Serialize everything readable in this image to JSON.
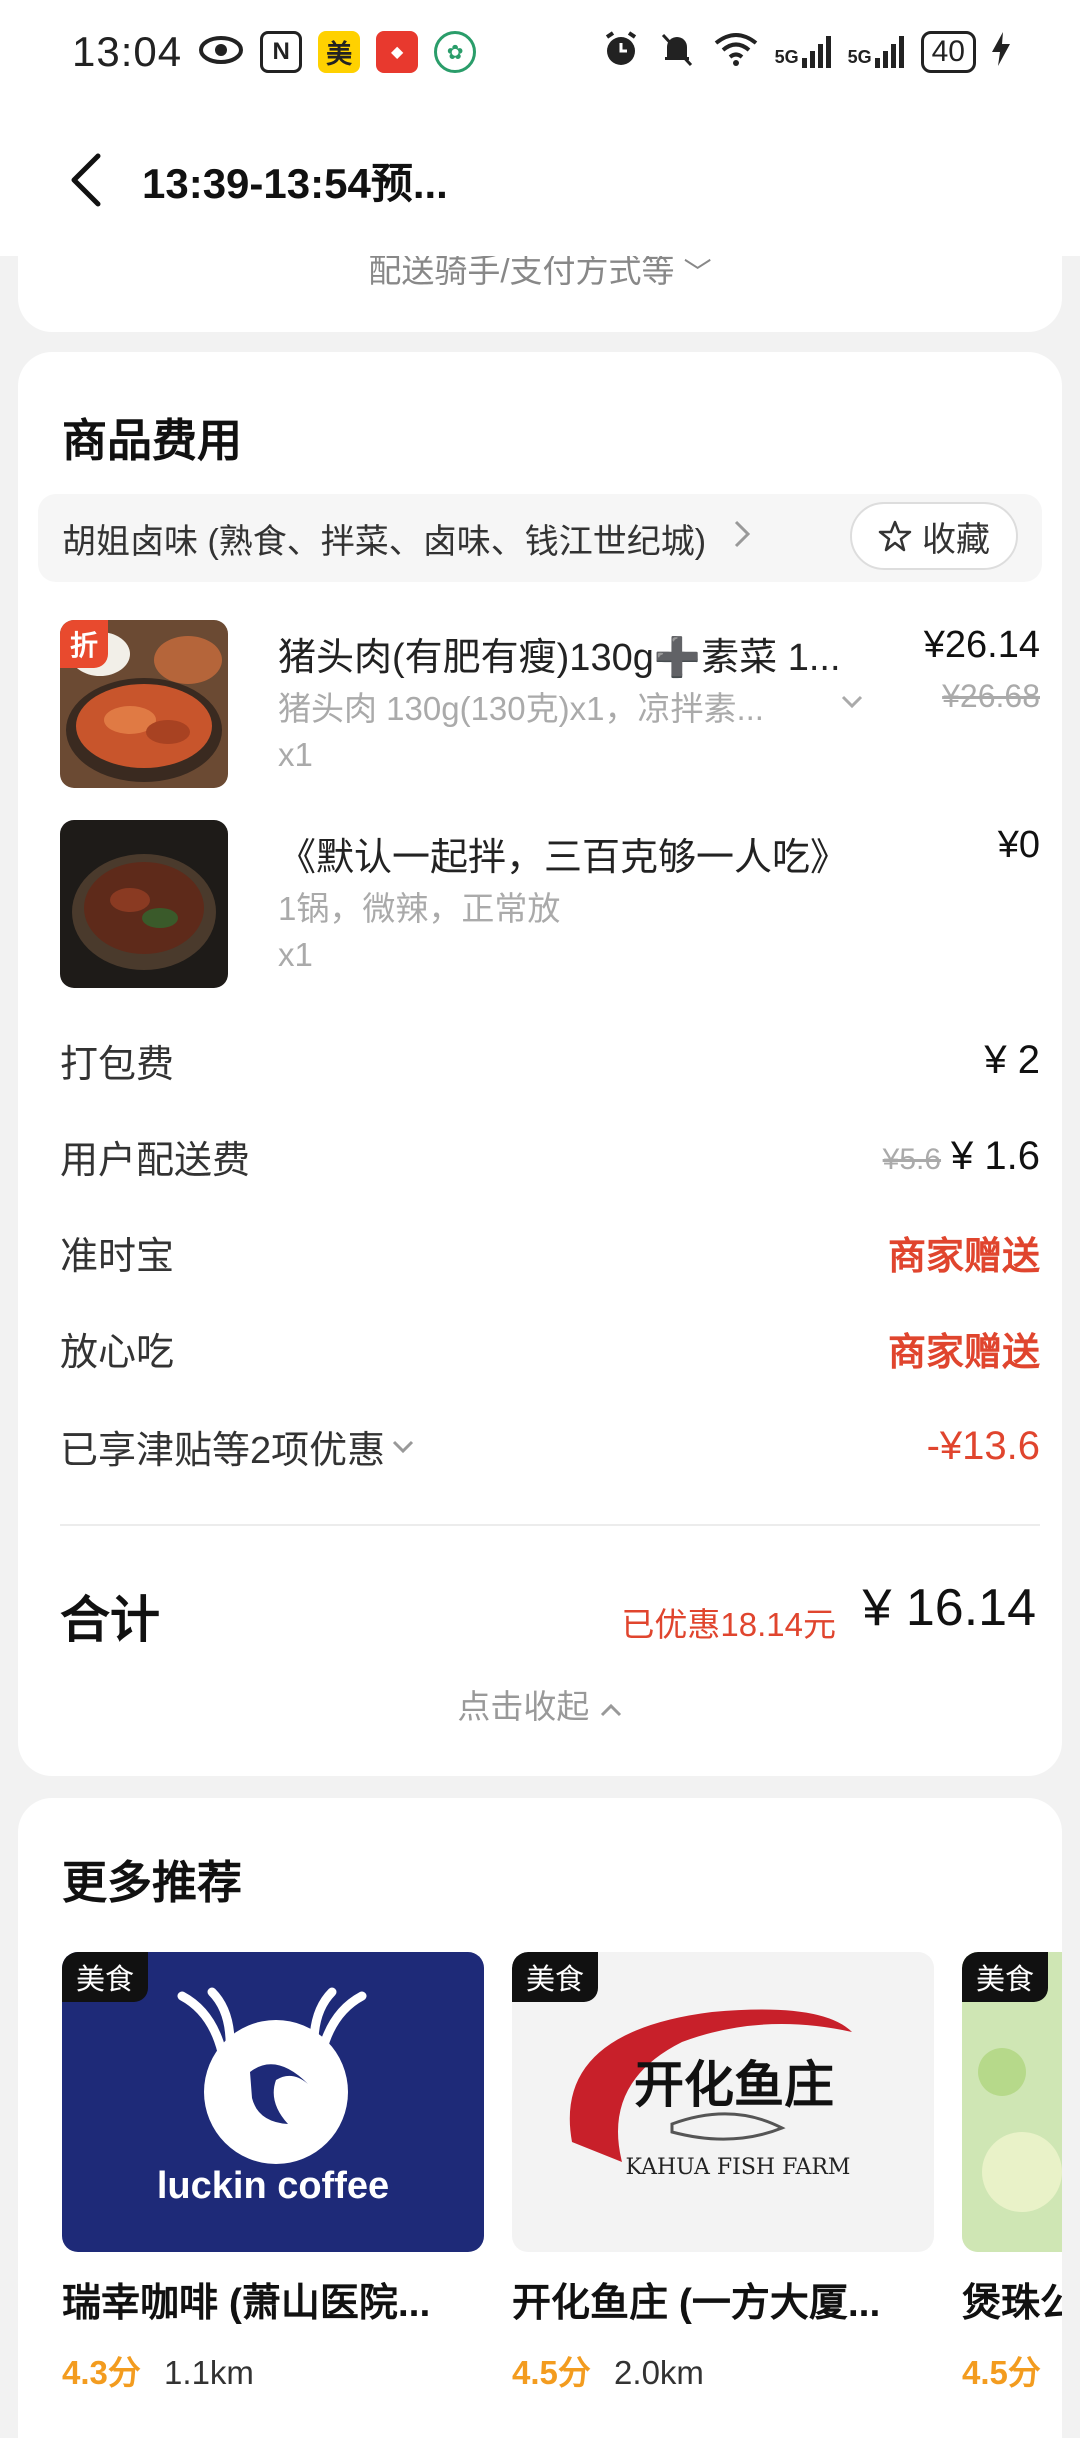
{
  "status_bar": {
    "time": "13:04",
    "app_icons": [
      "eye-icon",
      "nfc-icon",
      "meituan-icon",
      "news-icon",
      "leaf-icon"
    ],
    "network": [
      "5G",
      "5G"
    ],
    "battery": "40"
  },
  "header": {
    "title": "13:39-13:54预..."
  },
  "order_info": {
    "rider_link": "配送骑手/支付方式等"
  },
  "fee_section": {
    "title": "商品费用",
    "shop_name": "胡姐卤味 (熟食、拌菜、卤味、钱江世纪城)",
    "favorite_label": "收藏",
    "items": [
      {
        "name": "猪头肉(有肥有瘦)130g➕素菜 1...",
        "spec": "猪头肉 130g(130克)x1，凉拌素...",
        "qty": "x1",
        "price": "¥26.14",
        "original_price": "¥26.68",
        "tag": "折"
      },
      {
        "name": "《默认一起拌，三百克够一人吃》",
        "spec": "1锅，微辣，正常放",
        "qty": "x1",
        "price": "¥0"
      }
    ],
    "fees": {
      "packing": {
        "label": "打包费",
        "value": "¥ 2"
      },
      "delivery": {
        "label": "用户配送费",
        "original": "¥5.6",
        "value": "¥ 1.6"
      },
      "ontime": {
        "label": "准时宝",
        "value": "商家赠送"
      },
      "safe": {
        "label": "放心吃",
        "value": "商家赠送"
      },
      "discount": {
        "label": "已享津贴等2项优惠",
        "value": "-¥13.6"
      }
    },
    "total": {
      "label": "合计",
      "saved": "已优惠18.14元",
      "value": "¥ 16.14"
    },
    "collapse_label": "点击收起"
  },
  "recommendations": {
    "title": "更多推荐",
    "tag": "美食",
    "cards": [
      {
        "name": "瑞幸咖啡 (萧山医院...",
        "score": "4.3分",
        "distance": "1.1km",
        "logo_text": "luckin coffee"
      },
      {
        "name": "开化鱼庄 (一方大厦...",
        "score": "4.5分",
        "distance": "2.0km",
        "logo_text": "开化鱼庄",
        "logo_sub": "KAHUA FISH FARM"
      },
      {
        "name": "煲珠公",
        "score": "4.5分",
        "distance": ""
      }
    ]
  },
  "colors": {
    "accent_red": "#e0452e",
    "score_orange": "#f39c1f",
    "luckin_blue": "#1e2a78"
  }
}
